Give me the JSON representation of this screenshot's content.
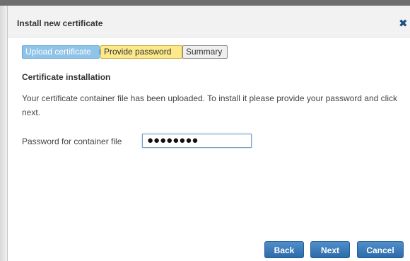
{
  "dialog": {
    "title": "Install new certificate",
    "close_label": "✖"
  },
  "steps": [
    {
      "label": "Upload certificate",
      "state": "completed"
    },
    {
      "label": "Provide password",
      "state": "current"
    },
    {
      "label": "Summary",
      "state": "pending"
    }
  ],
  "content": {
    "section_title": "Certificate installation",
    "description": "Your certificate container file has been uploaded. To install it please provide your password and click next.",
    "password_label": "Password for container file",
    "password_value": "●●●●●●●●"
  },
  "buttons": {
    "back": "Back",
    "next": "Next",
    "cancel": "Cancel"
  },
  "colors": {
    "button_blue": "#2d6aa8",
    "step_completed": "#8fc3e8",
    "step_current": "#fbe98a",
    "step_pending": "#efefef",
    "close_icon": "#1a4f82"
  }
}
